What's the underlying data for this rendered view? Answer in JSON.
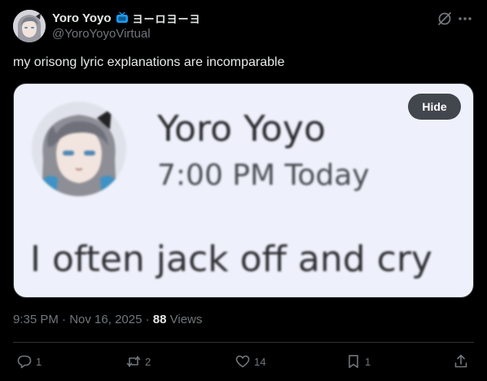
{
  "author": {
    "display_name": "Yoro Yoyo",
    "name_extra": "ヨーロヨーヨ",
    "handle": "@YoroYoyoVirtual"
  },
  "post": {
    "text": "my orisong lyric explanations are incomparable",
    "hide_label": "Hide"
  },
  "media": {
    "name": "Yoro Yoyo",
    "time": "7:00 PM Today",
    "message": "I often jack off and cry"
  },
  "meta": {
    "time": "9:35 PM",
    "sep1": " · ",
    "date": "Nov 16, 2025",
    "sep2": " · ",
    "views_count": "88",
    "views_label": " Views"
  },
  "actions": {
    "replies": "1",
    "reposts": "2",
    "likes": "14",
    "bookmarks": "1"
  },
  "icons": {
    "badge": "tv-icon",
    "grok": "grok-icon",
    "more": "more-icon",
    "reply": "reply-icon",
    "repost": "repost-icon",
    "like": "heart-icon",
    "bookmark": "bookmark-icon",
    "share": "share-icon"
  },
  "colors": {
    "background": "#000000",
    "text": "#e7e9ea",
    "secondary": "#71767b",
    "badge": "#1d9bf0",
    "media_background": "#eef1fb"
  }
}
